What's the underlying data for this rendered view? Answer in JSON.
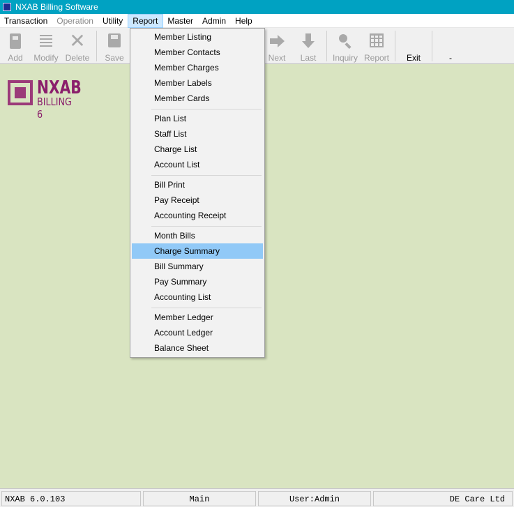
{
  "window": {
    "title": "NXAB Billing Software"
  },
  "menubar": [
    {
      "label": "Transaction",
      "state": "normal"
    },
    {
      "label": "Operation",
      "state": "disabled"
    },
    {
      "label": "Utility",
      "state": "normal"
    },
    {
      "label": "Report",
      "state": "active"
    },
    {
      "label": "Master",
      "state": "normal"
    },
    {
      "label": "Admin",
      "state": "normal"
    },
    {
      "label": "Help",
      "state": "normal"
    }
  ],
  "toolbar": {
    "add": "Add",
    "modify": "Modify",
    "delete": "Delete",
    "save": "Save",
    "next": "Next",
    "last": "Last",
    "inquiry": "Inquiry",
    "report": "Report",
    "exit": "Exit",
    "dash": "-"
  },
  "logo": {
    "brand": "NXAB",
    "sub": "BILLING 6"
  },
  "report_menu": {
    "groups": [
      [
        "Member Listing",
        "Member Contacts",
        "Member Charges",
        "Member Labels",
        "Member Cards"
      ],
      [
        "Plan List",
        "Staff List",
        "Charge List",
        "Account List"
      ],
      [
        "Bill Print",
        "Pay Receipt",
        "Accounting Receipt"
      ],
      [
        "Month Bills",
        "Charge Summary",
        "Bill Summary",
        "Pay Summary",
        "Accounting List"
      ],
      [
        "Member Ledger",
        "Account Ledger",
        "Balance Sheet"
      ]
    ],
    "highlighted": "Charge Summary"
  },
  "statusbar": {
    "version": "NXAB 6.0.103",
    "module": "Main",
    "user": "User:Admin",
    "company": "DE Care Ltd"
  },
  "colors": {
    "titlebar": "#00a2c2",
    "workspace": "#d9e4c1",
    "logo": "#8a1e6b",
    "menu_highlight": "#91c9f7"
  }
}
